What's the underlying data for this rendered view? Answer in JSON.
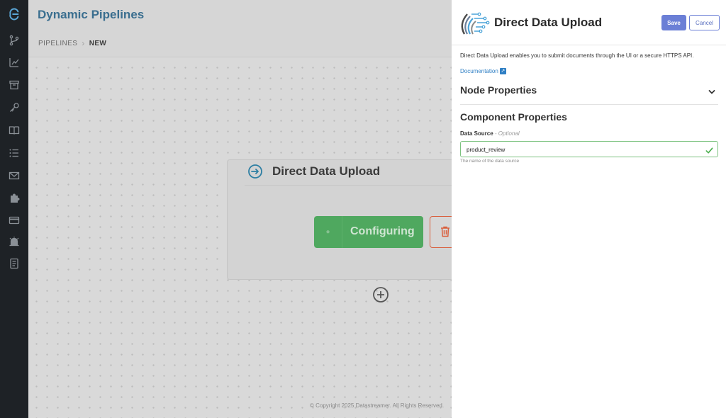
{
  "app": {
    "title": "Dynamic Pipelines"
  },
  "breadcrumb": {
    "items": [
      "PIPELINES",
      "NEW"
    ]
  },
  "sidebar": {
    "icons": [
      "logo-icon",
      "branch-icon",
      "chart-icon",
      "archive-icon",
      "key-icon",
      "book-icon",
      "list-icon",
      "mail-icon",
      "puzzle-icon",
      "card-icon",
      "alarm-icon",
      "document-icon"
    ]
  },
  "canvas": {
    "node_title": "Direct Data Upload",
    "configuring_label": "Configuring",
    "copyright": "© Copyright 2025 Datastreamer. All Rights Reserved."
  },
  "panel": {
    "title": "Direct Data Upload",
    "save_label": "Save",
    "cancel_label": "Cancel",
    "description": "Direct Data Upload enables you to submit documents through the UI or a secure HTTPS API.",
    "documentation_label": "Documentation",
    "node_properties_label": "Node Properties",
    "component_properties_label": "Component Properties",
    "data_source": {
      "label": "Data Source",
      "optional_label": "- Optional",
      "value": "product_review",
      "hint": "The name of the data source"
    }
  },
  "colors": {
    "primary": "#6b7fd6",
    "success": "#4fa85f",
    "danger": "#d9603e",
    "link": "#2f7fc4",
    "title_blue": "#3a6e8f"
  }
}
